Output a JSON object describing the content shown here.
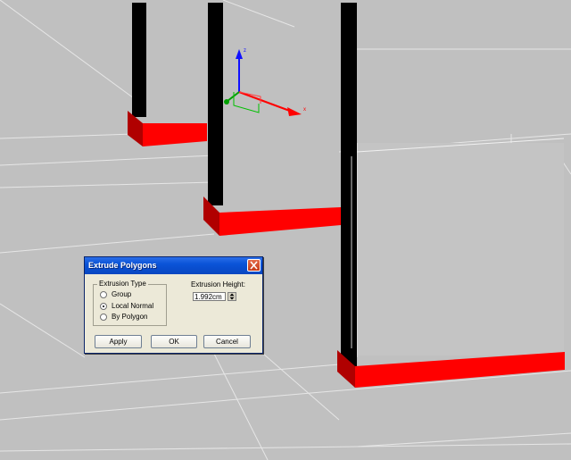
{
  "viewport": {
    "background_color": "#c0c0c0",
    "pillar_color": "#000000",
    "baseboard_color": "#ff0000",
    "gizmo_axes": [
      {
        "axis": "z",
        "label": "z",
        "color": "#1010ff"
      },
      {
        "axis": "x",
        "label": "x",
        "color": "#ff0000"
      },
      {
        "axis": "y",
        "label": "",
        "color": "#00a000"
      }
    ]
  },
  "dialog": {
    "title": "Extrude Polygons",
    "close_icon": "close-icon",
    "extrusion_type": {
      "label": "Extrusion Type",
      "options": [
        {
          "label": "Group",
          "selected": false
        },
        {
          "label": "Local Normal",
          "selected": true
        },
        {
          "label": "By Polygon",
          "selected": false
        }
      ]
    },
    "extrusion_height": {
      "label": "Extrusion Height:",
      "value": "1.992cm"
    },
    "buttons": {
      "apply": "Apply",
      "ok": "OK",
      "cancel": "Cancel"
    }
  }
}
